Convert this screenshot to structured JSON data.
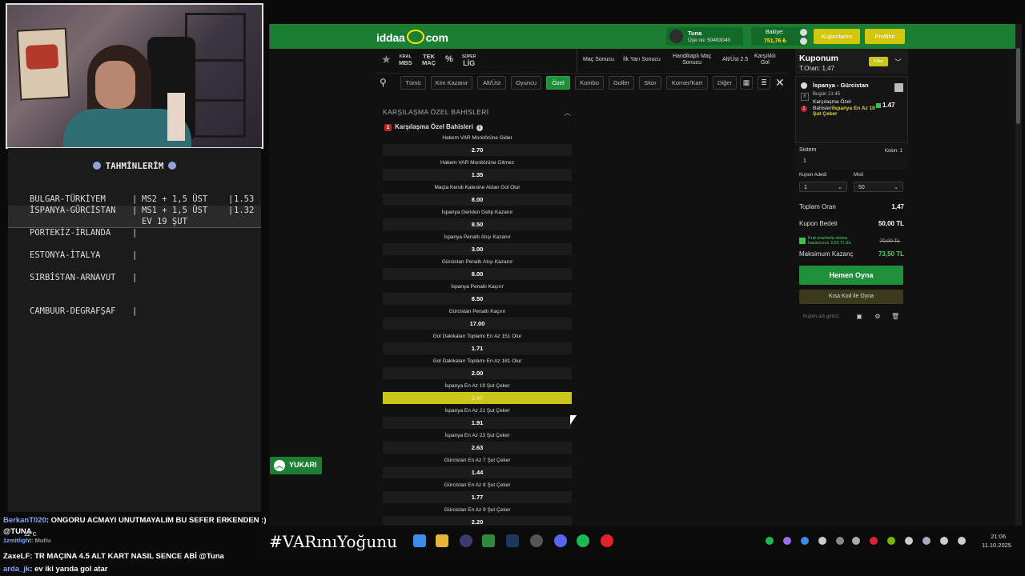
{
  "predictions": {
    "title": "TAHMİNLERİM",
    "rows": [
      {
        "match": "BULGAR-TÜRKİYEM",
        "pick": "MS2 + 1,5 ÜST",
        "odd": "1.53"
      },
      {
        "match": "İSPANYA-GÜRCİSTAN",
        "pick": "MS1 + 1,5 ÜST",
        "odd": "1.32"
      },
      {
        "match": "",
        "pick": "EV 19 ŞUT",
        "odd": ""
      },
      {
        "match": "PORTEKİZ-İRLANDA",
        "pick": "",
        "odd": ""
      },
      {
        "match": "ESTONYA-İTALYA",
        "pick": "",
        "odd": ""
      },
      {
        "match": "SIRBİSTAN-ARNAVUT",
        "pick": "",
        "odd": ""
      },
      {
        "match": "CAMBUUR-DEGRAFŞAF",
        "pick": "",
        "odd": ""
      }
    ]
  },
  "chat": [
    {
      "user": "BerkanT020",
      "msg": ": ONGORU ACMAYI UNUTMAYALIM BU SEFER ERKENDEN :)"
    },
    {
      "user": "",
      "msg": "@TUNA"
    },
    {
      "user": "1zmitlight",
      "msg": ": Mutlu"
    },
    {
      "user": "ZaxeLF",
      "msg": ": TR MAÇINA 4.5 ALT KART NASIL SENCE ABİ @Tuna"
    },
    {
      "user": "arda_jk",
      "msg": ": ev iki yarıda gol atar"
    }
  ],
  "weather": "12°C",
  "site": {
    "logo": "iddaa",
    "logo_suffix": "com",
    "user_name": "Tuna",
    "user_no": "Üye no: 50493040",
    "balance_label": "Bakiye:",
    "balance_value": "751,76 ₺",
    "btn_coupons": "Kuponlarım",
    "btn_profile": "Profilim"
  },
  "subnav": {
    "left": [
      {
        "l1": "KRAL",
        "l2": "MBS"
      },
      {
        "l1": "TEK",
        "l2": "MAÇ"
      },
      {
        "l1": "%",
        "l2": ""
      },
      {
        "l1": "SÜPER",
        "l2": "LİG"
      }
    ],
    "markets": [
      {
        "l1": "Maç Sonucu",
        "l2": ""
      },
      {
        "l1": "İlk Yarı Sonucu",
        "l2": ""
      },
      {
        "l1": "Handikaplı Maç",
        "l2": "Sonucu"
      },
      {
        "l1": "Alt/Üst 2.5",
        "l2": ""
      },
      {
        "l1": "Karşılıklı",
        "l2": "Gol"
      }
    ]
  },
  "filters": [
    "Tümü",
    "Kim Kazanır",
    "Alt/Üst",
    "Oyuncu",
    "Özel",
    "Kombo",
    "Goller",
    "Skor",
    "Korner/Kart",
    "Diğer"
  ],
  "active_filter": "Özel",
  "section": {
    "title": "KARŞILAŞMA ÖZEL BAHİSLERİ",
    "sub_num": "1",
    "sub_title": "Karşılaşma Özel Bahisleri"
  },
  "odds": [
    {
      "label": "Hakem VAR Monitörüne Gider",
      "value": "2.70"
    },
    {
      "label": "Hakem VAR Monitörüne Gitmez",
      "value": "1.35"
    },
    {
      "label": "Maçta Kendi Kalesine Atılan Gol Olur",
      "value": "8.00"
    },
    {
      "label": "İspanya Geriden Gelip Kazanır",
      "value": "8.50"
    },
    {
      "label": "İspanya Penaltı Atışı Kazanır",
      "value": "3.00"
    },
    {
      "label": "Gürcistan Penaltı Atışı Kazanır",
      "value": "8.00"
    },
    {
      "label": "İspanya Penaltı Kaçırır",
      "value": "8.50"
    },
    {
      "label": "Gürcistan Penaltı Kaçırır",
      "value": "17.00"
    },
    {
      "label": "Gol Dakikaları Toplamı En Az 151 Olur",
      "value": "1.71"
    },
    {
      "label": "Gol Dakikaları Toplamı En Az 181 Olur",
      "value": "2.00"
    },
    {
      "label": "İspanya En Az 19 Şut Çeker",
      "value": "1.47",
      "selected": true
    },
    {
      "label": "İspanya En Az 21 Şut Çeker",
      "value": "1.91"
    },
    {
      "label": "İspanya En Az 23 Şut Çeker",
      "value": "2.63"
    },
    {
      "label": "Gürcistan En Az 7 Şut Çeker",
      "value": "1.44"
    },
    {
      "label": "Gürcistan En Az 8 Şut Çeker",
      "value": "1.77"
    },
    {
      "label": "Gürcistan En Az 9 Şut Çeker",
      "value": "2.20"
    }
  ],
  "scroll_top_label": "YUKARI",
  "coupon": {
    "title": "Kuponum",
    "total_odds": "T.Oran: 1,47",
    "badge": "Filtre",
    "match": "İspanya - Gürcistan",
    "date": "Bugün 21:45",
    "bet_prefix": "Karşılaşma Özel Bahisleri",
    "bet_pick": "İspanya En Az 19 Şut Çeker",
    "odd": "1.47",
    "system_label": "Sistem",
    "column_label": "Kolon: 1",
    "system_value": "1",
    "coupon_count_label": "Kupon Adedi",
    "coupon_count_value": "1",
    "multi_label": "Misli",
    "multi_value": "50",
    "total_odds_label": "Toplam Oran",
    "total_odds_value": "1,47",
    "stake_label": "Kupon Bedeli",
    "stake_value": "50,00 TL",
    "bonus_text_1": "Kral oranlarla ekstra",
    "bonus_text_2": "kazancınız 3,50 TL'dir.",
    "bonus_strike": "70,00 TL",
    "max_win_label": "Maksimum Kazanç",
    "max_win_value": "73,50 TL",
    "play_button": "Hemen Oyna",
    "short_code_button": "Kısa Kod ile Oyna",
    "coupon_name_placeholder": "Kupon adı giriniz"
  },
  "taskbar": {
    "hashtag": "#VARınıYoğunu",
    "time": "21:06",
    "date": "11.10.2025"
  }
}
